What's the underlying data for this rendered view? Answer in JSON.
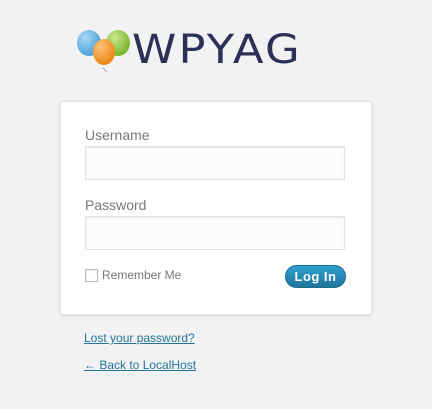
{
  "brand": {
    "logo_text": "WPYAG",
    "colors": {
      "balloon_blue": "#5aaee0",
      "balloon_green": "#8cc63f",
      "balloon_orange": "#f7941d",
      "text": "#2b3057"
    }
  },
  "login_form": {
    "username_label": "Username",
    "username_value": "",
    "password_label": "Password",
    "password_value": "",
    "remember_label": "Remember Me",
    "remember_checked": false,
    "submit_label": "Log In"
  },
  "links": {
    "lost_password": "Lost your password?",
    "back_to_site": "← Back to LocalHost"
  },
  "theme": {
    "accent": "#21759b",
    "background": "#f2f2f2"
  }
}
